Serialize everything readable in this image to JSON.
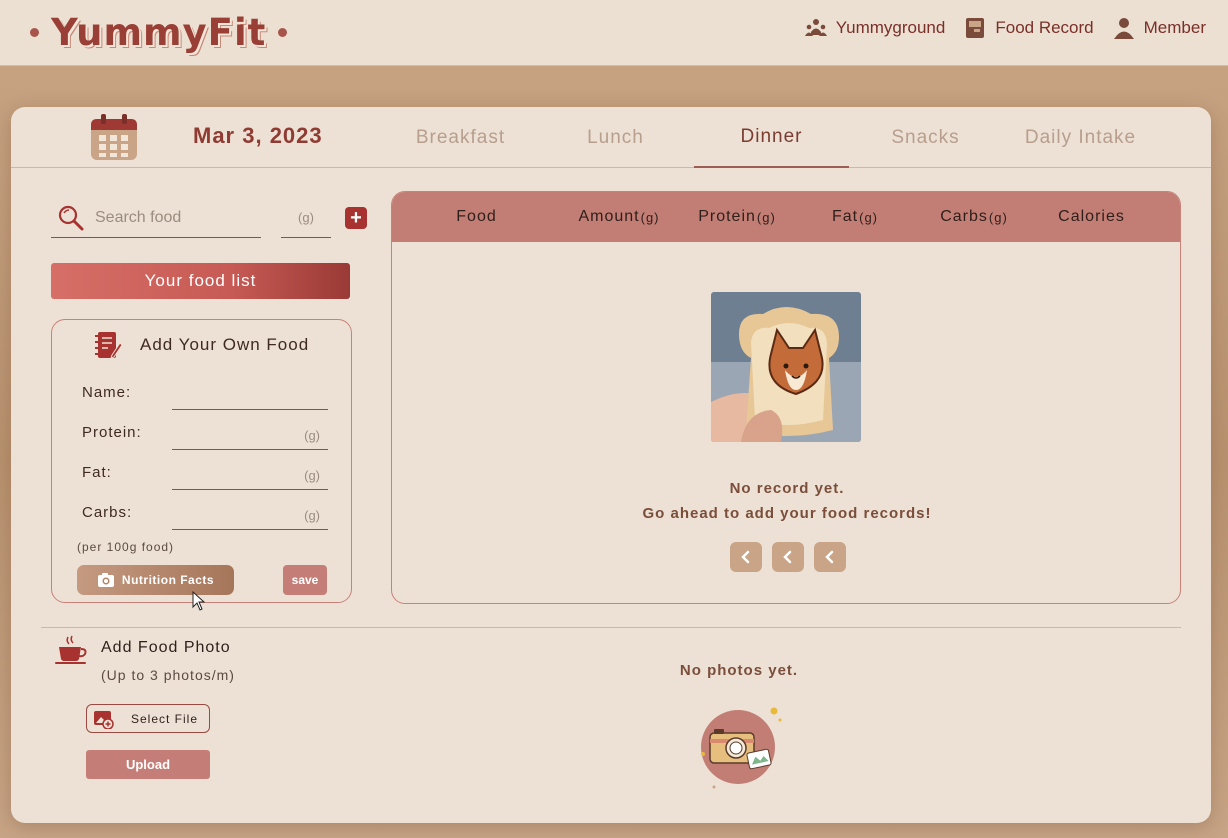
{
  "brand": {
    "name": "YummyFit"
  },
  "nav": [
    {
      "label": "Yummyground",
      "icon": "people-icon"
    },
    {
      "label": "Food Record",
      "icon": "record-book-icon"
    },
    {
      "label": "Member",
      "icon": "user-icon"
    }
  ],
  "date": "Mar 3, 2023",
  "tabs": [
    {
      "label": "Breakfast",
      "active": false
    },
    {
      "label": "Lunch",
      "active": false
    },
    {
      "label": "Dinner",
      "active": true
    },
    {
      "label": "Snacks",
      "active": false
    },
    {
      "label": "Daily Intake",
      "active": false
    }
  ],
  "search": {
    "placeholder": "Search food",
    "unit_placeholder": "(g)",
    "add_label": "+"
  },
  "food_list_button": "Your food list",
  "own_food": {
    "title": "Add Your Own Food",
    "fields": [
      {
        "label": "Name:",
        "unit": ""
      },
      {
        "label": "Protein:",
        "unit": "(g)"
      },
      {
        "label": "Fat:",
        "unit": "(g)"
      },
      {
        "label": "Carbs:",
        "unit": "(g)"
      }
    ],
    "note": "(per 100g food)",
    "nutrition_button": "Nutrition Facts",
    "save_button": "save"
  },
  "table": {
    "columns": [
      {
        "label": "Food",
        "unit": ""
      },
      {
        "label": "Amount",
        "unit": "(g)"
      },
      {
        "label": "Protein",
        "unit": "(g)"
      },
      {
        "label": "Fat",
        "unit": "(g)"
      },
      {
        "label": "Carbs",
        "unit": "(g)"
      },
      {
        "label": "Calories",
        "unit": ""
      }
    ],
    "empty_line1": "No record yet.",
    "empty_line2": "Go ahead to add your food records!"
  },
  "photo": {
    "title": "Add Food Photo",
    "subtitle": "(Up to 3 photos/m)",
    "select_label": "Select File",
    "upload_label": "Upload",
    "empty": "No photos yet."
  },
  "colors": {
    "brand": "#9a3f36",
    "accent": "#c27e75",
    "background": "#ede1d5",
    "nav_text": "#7a2f28"
  }
}
